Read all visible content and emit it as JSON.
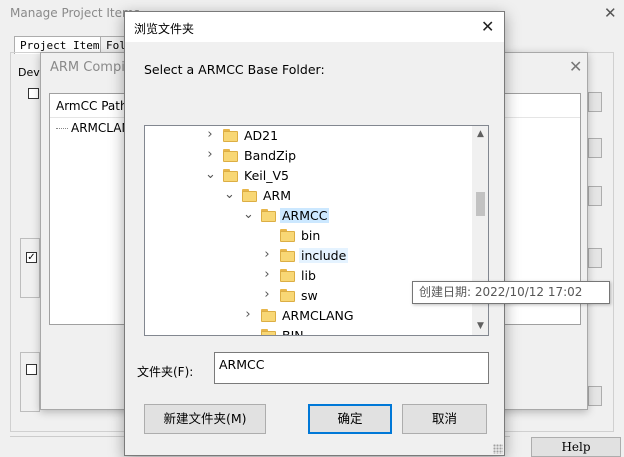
{
  "background_window": {
    "title": "Manage Project Items",
    "tabs": [
      "Project Items",
      "Fol"
    ],
    "dev_label": "Deve",
    "help_label": "Help"
  },
  "compiler_window": {
    "title": "ARM Compile",
    "column_header": "ArmCC Path",
    "item": "ARMCLAN"
  },
  "dialog": {
    "title": "浏览文件夹",
    "prompt": "Select a ARMCC Base Folder:",
    "tree": [
      {
        "label": "AD21",
        "expander": "collapsed",
        "state": ""
      },
      {
        "label": "BandZip",
        "expander": "collapsed",
        "state": ""
      },
      {
        "label": "Keil_V5",
        "expander": "expanded",
        "state": ""
      },
      {
        "label": "ARM",
        "expander": "expanded",
        "state": ""
      },
      {
        "label": "ARMCC",
        "expander": "expanded",
        "state": "selected"
      },
      {
        "label": "bin",
        "expander": "none",
        "state": ""
      },
      {
        "label": "include",
        "expander": "collapsed",
        "state": "hover"
      },
      {
        "label": "lib",
        "expander": "collapsed",
        "state": ""
      },
      {
        "label": "sw",
        "expander": "collapsed",
        "state": ""
      },
      {
        "label": "ARMCLANG",
        "expander": "collapsed",
        "state": ""
      },
      {
        "label": "BIN",
        "expander": "none",
        "state": ""
      }
    ],
    "tooltip": "创建日期: 2022/10/12 17:02",
    "folder_label": "文件夹(F):",
    "folder_value": "ARMCC",
    "buttons": {
      "new_folder": "新建文件夹(M)",
      "ok": "确定",
      "cancel": "取消"
    }
  }
}
